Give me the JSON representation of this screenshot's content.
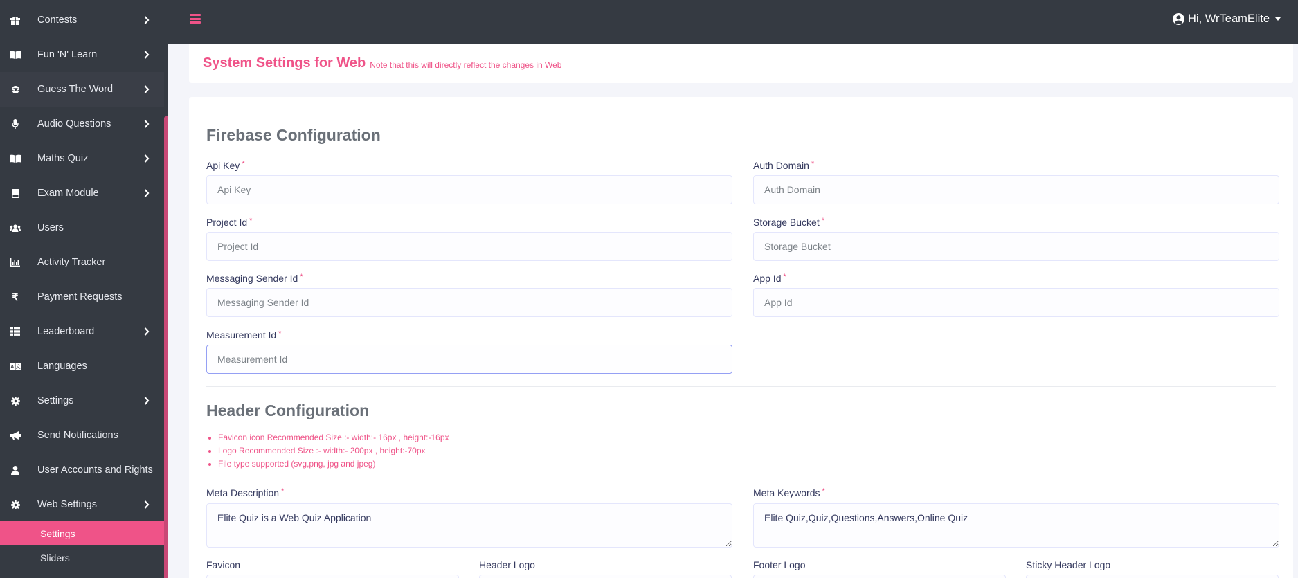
{
  "sidebar": {
    "items": [
      {
        "label": "Contests",
        "icon": "gift-icon",
        "has_children": true
      },
      {
        "label": "Fun 'N' Learn",
        "icon": "book-open-icon",
        "has_children": true
      },
      {
        "label": "Guess The Word",
        "icon": "atom-icon",
        "has_children": true
      },
      {
        "label": "Audio Questions",
        "icon": "microphone-icon",
        "has_children": true
      },
      {
        "label": "Maths Quiz",
        "icon": "book-open-icon",
        "has_children": true
      },
      {
        "label": "Exam Module",
        "icon": "book-icon",
        "has_children": true
      },
      {
        "label": "Users",
        "icon": "users-icon",
        "has_children": false
      },
      {
        "label": "Activity Tracker",
        "icon": "chart-bar-icon",
        "has_children": false
      },
      {
        "label": "Payment Requests",
        "icon": "rupee-icon",
        "has_children": false
      },
      {
        "label": "Leaderboard",
        "icon": "grid-icon",
        "has_children": true
      },
      {
        "label": "Languages",
        "icon": "language-icon",
        "has_children": false
      },
      {
        "label": "Settings",
        "icon": "gear-icon",
        "has_children": true
      },
      {
        "label": "Send Notifications",
        "icon": "megaphone-icon",
        "has_children": false
      },
      {
        "label": "User Accounts and Rights",
        "icon": "user-icon",
        "has_children": false
      },
      {
        "label": "Web Settings",
        "icon": "gear-icon",
        "has_children": true
      }
    ],
    "sub_items": [
      {
        "label": "Settings",
        "active": true
      },
      {
        "label": "Sliders",
        "active": false
      }
    ]
  },
  "topbar": {
    "greeting": "Hi, WrTeamElite"
  },
  "page": {
    "title": "System Settings for Web",
    "note": "Note that this will directly reflect the changes in Web"
  },
  "firebase": {
    "title": "Firebase Configuration",
    "fields": {
      "api_key": {
        "label": "Api Key",
        "placeholder": "Api Key",
        "value": ""
      },
      "auth_domain": {
        "label": "Auth Domain",
        "placeholder": "Auth Domain",
        "value": ""
      },
      "project_id": {
        "label": "Project Id",
        "placeholder": "Project Id",
        "value": ""
      },
      "storage_bucket": {
        "label": "Storage Bucket",
        "placeholder": "Storage Bucket",
        "value": ""
      },
      "messaging_sender_id": {
        "label": "Messaging Sender Id",
        "placeholder": "Messaging Sender Id",
        "value": ""
      },
      "app_id": {
        "label": "App Id",
        "placeholder": "App Id",
        "value": ""
      },
      "measurement_id": {
        "label": "Measurement Id",
        "placeholder": "Measurement Id",
        "value": ""
      }
    },
    "required_mark": "*"
  },
  "header_config": {
    "title": "Header Configuration",
    "notes": [
      "Favicon icon Recommended Size :- width:- 16px , height:-16px",
      "Logo Recommended Size :- width:- 200px , height:-70px",
      "File type supported (svg,png, jpg and jpeg)"
    ],
    "meta_description": {
      "label": "Meta Description",
      "value": "Elite Quiz is a Web Quiz Application"
    },
    "meta_keywords": {
      "label": "Meta Keywords",
      "value": "Elite Quiz,Quiz,Questions,Answers,Online Quiz"
    },
    "uploads": [
      {
        "label": "Favicon"
      },
      {
        "label": "Header Logo"
      },
      {
        "label": "Footer Logo"
      },
      {
        "label": "Sticky Header Logo"
      }
    ]
  },
  "colors": {
    "accent": "#ef5388",
    "sidebar_bg": "#353a42",
    "page_bg": "#f4f5fa"
  }
}
